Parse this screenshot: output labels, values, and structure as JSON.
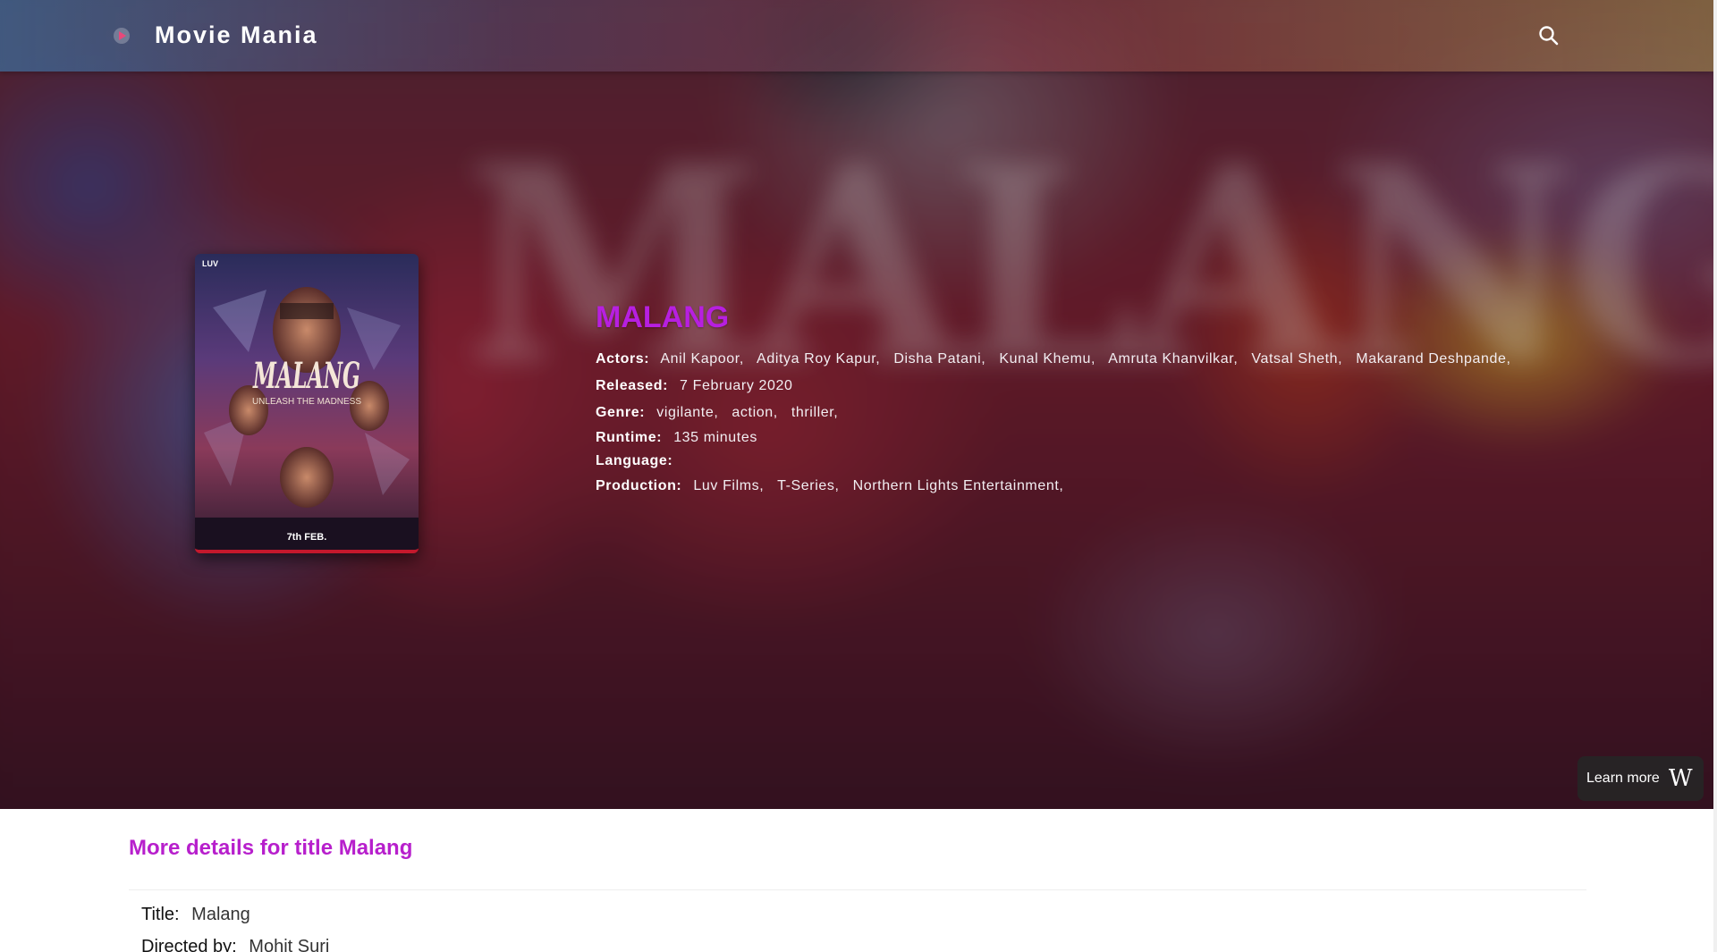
{
  "header": {
    "brand": "Movie Mania",
    "search_icon": "search-icon",
    "logo_icon": "play-icon"
  },
  "movie": {
    "title": "MALANG",
    "actors_label": "Actors:",
    "actors": [
      "Anil Kapoor,",
      "Aditya Roy Kapur,",
      "Disha Patani,",
      "Kunal Khemu,",
      "Amruta Khanvilkar,",
      "Vatsal Sheth,",
      "Makarand Deshpande,"
    ],
    "released_label": "Released:",
    "released": "7 February 2020",
    "genre_label": "Genre:",
    "genres": [
      "vigilante,",
      "action,",
      "thriller,"
    ],
    "runtime_label": "Runtime:",
    "runtime": "135 minutes",
    "language_label": "Language:",
    "language": "",
    "production_label": "Production:",
    "production": [
      "Luv Films,",
      "T-Series,",
      "Northern Lights Entertainment,"
    ]
  },
  "poster": {
    "top_left": "LUV",
    "title": "MALANG",
    "tagline": "UNLEASH THE MADNESS",
    "date": "7th FEB."
  },
  "learn_more": {
    "label": "Learn more",
    "icon": "W"
  },
  "details": {
    "heading": "More details for title Malang",
    "title_label": "Title:",
    "title_value": "Malang",
    "directed_label": "Directed by:",
    "directed_value": "Mohit Suri"
  },
  "colors": {
    "accent": "#b71fe0",
    "heading": "#b71fcc"
  }
}
